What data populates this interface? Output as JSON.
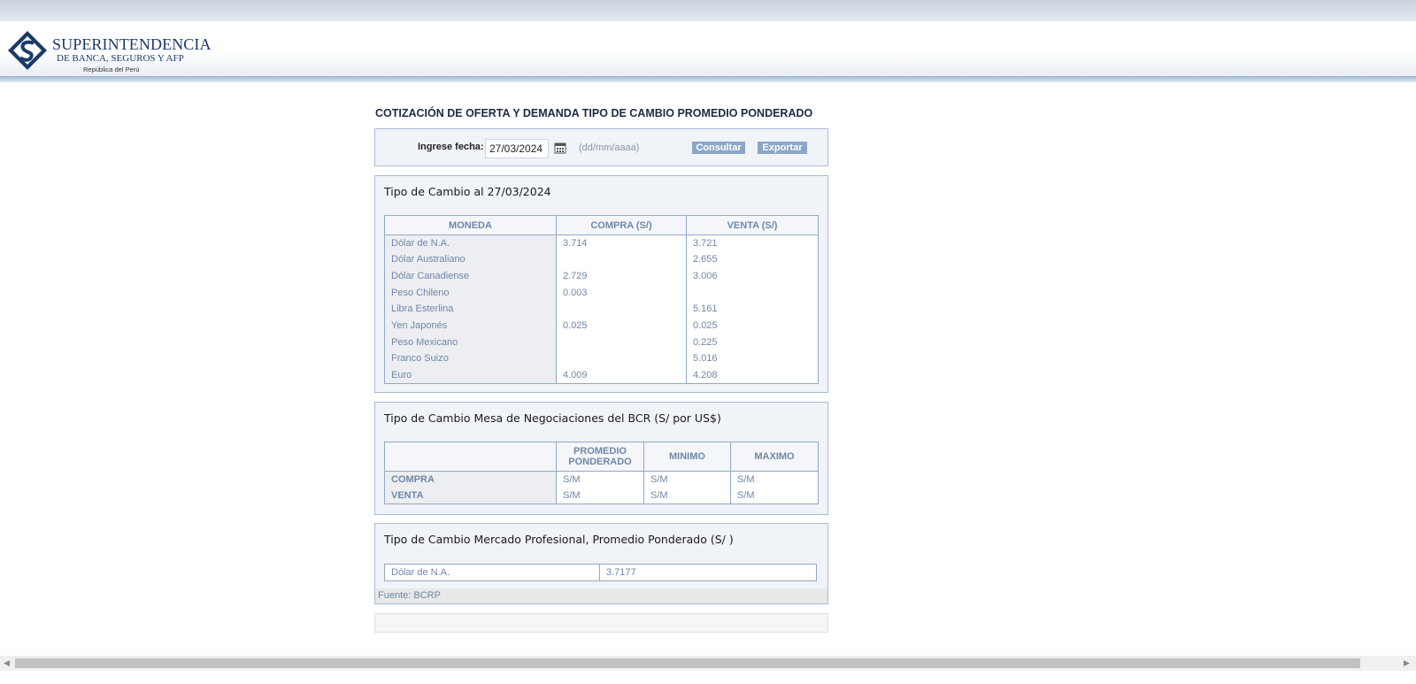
{
  "header": {
    "logo_line1": "SUPERINTENDENCIA",
    "logo_line2": "DE BANCA, SEGUROS Y AFP",
    "logo_line3": "República del Perú"
  },
  "page_title": "COTIZACIÓN DE OFERTA Y DEMANDA TIPO DE CAMBIO PROMEDIO PONDERADO",
  "search": {
    "label": "Ingrese fecha:",
    "date_value": "27/03/2024",
    "format_hint": "(dd/mm/aaaa)",
    "consultar_label": "Consultar",
    "exportar_label": "Exportar"
  },
  "exchange": {
    "title": "Tipo de Cambio al 27/03/2024",
    "headers": [
      "MONEDA",
      "COMPRA (S/)",
      "VENTA (S/)"
    ],
    "rows": [
      [
        "Dólar de N.A.",
        "3.714",
        "3.721"
      ],
      [
        "Dólar Australiano",
        "",
        "2.655"
      ],
      [
        "Dólar Canadiense",
        "2.729",
        "3.006"
      ],
      [
        "Peso Chileno",
        "0.003",
        ""
      ],
      [
        "Libra Esterlina",
        "",
        "5.161"
      ],
      [
        "Yen Japonés",
        "0.025",
        "0.025"
      ],
      [
        "Peso Mexicano",
        "",
        "0.225"
      ],
      [
        "Franco Suizo",
        "",
        "5.016"
      ],
      [
        "Euro",
        "4.009",
        "4.208"
      ]
    ]
  },
  "bcr": {
    "title": "Tipo de Cambio Mesa de Negociaciones del BCR (S/ por US$)",
    "headers": [
      "",
      "PROMEDIO PONDERADO",
      "MINIMO",
      "MAXIMO"
    ],
    "rows": [
      [
        "COMPRA",
        "S/M",
        "S/M",
        "S/M"
      ],
      [
        "VENTA",
        "S/M",
        "S/M",
        "S/M"
      ]
    ]
  },
  "profesional": {
    "title": "Tipo de Cambio Mercado Profesional, Promedio Ponderado (S/ )",
    "currency": "Dólar de N.A.",
    "value": "3.7177",
    "source": "Fuente: BCRP"
  },
  "colors": {
    "accent": "#8ba6c8",
    "table_text": "#6f87a8",
    "brand": "#1b3a6b"
  }
}
